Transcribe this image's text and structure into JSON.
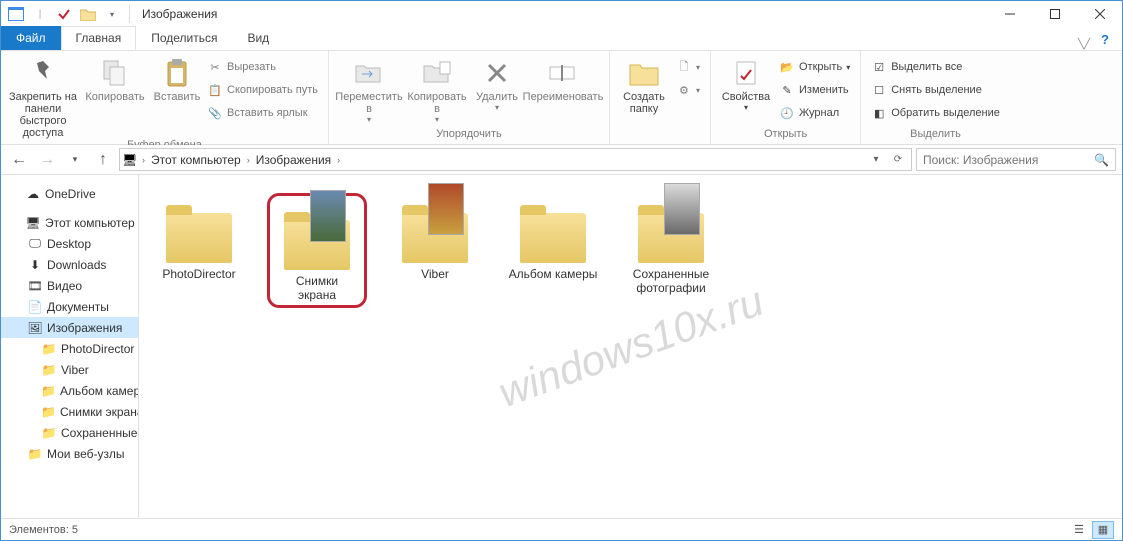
{
  "window": {
    "title": "Изображения"
  },
  "tabs": {
    "file": "Файл",
    "home": "Главная",
    "share": "Поделиться",
    "view": "Вид"
  },
  "ribbon": {
    "pin": "Закрепить на панели быстрого доступа",
    "copy": "Копировать",
    "paste": "Вставить",
    "cut": "Вырезать",
    "copypath": "Скопировать путь",
    "pasteshortcut": "Вставить ярлык",
    "group_clipboard": "Буфер обмена",
    "moveto": "Переместить в",
    "copyto": "Копировать в",
    "delete": "Удалить",
    "rename": "Переименовать",
    "group_organize": "Упорядочить",
    "newfolder": "Создать папку",
    "group_new": "",
    "properties": "Свойства",
    "open_btn": "Открыть",
    "edit_btn": "Изменить",
    "history": "Журнал",
    "group_open": "Открыть",
    "selectall": "Выделить все",
    "selectnone": "Снять выделение",
    "invertsel": "Обратить выделение",
    "group_select": "Выделить"
  },
  "address": {
    "seg1": "Этот компьютер",
    "seg2": "Изображения"
  },
  "search": {
    "placeholder": "Поиск: Изображения"
  },
  "tree": {
    "onedrive": "OneDrive",
    "thispc": "Этот компьютер",
    "desktop": "Desktop",
    "downloads": "Downloads",
    "video": "Видео",
    "documents": "Документы",
    "pictures": "Изображения",
    "photodirector": "PhotoDirector",
    "viber": "Viber",
    "album": "Альбом камеры",
    "screenshots": "Снимки экрана",
    "saved": "Сохраненные",
    "favorites": "Мои веб-узлы"
  },
  "items": [
    {
      "name": "PhotoDirector",
      "thumb": false
    },
    {
      "name": "Снимки экрана",
      "thumb": true,
      "highlight": true,
      "thumbColor": "linear-gradient(#6a8ab0,#4a6a3a)"
    },
    {
      "name": "Viber",
      "thumb": true,
      "thumbColor": "linear-gradient(#b04a2a,#c8a040)"
    },
    {
      "name": "Альбом камеры",
      "thumb": false
    },
    {
      "name": "Сохраненные фотографии",
      "thumb": true,
      "thumbColor": "linear-gradient(#dadada,#6a6a6a)"
    }
  ],
  "status": {
    "count_label": "Элементов:",
    "count": "5"
  },
  "watermark": "windows10x.ru"
}
